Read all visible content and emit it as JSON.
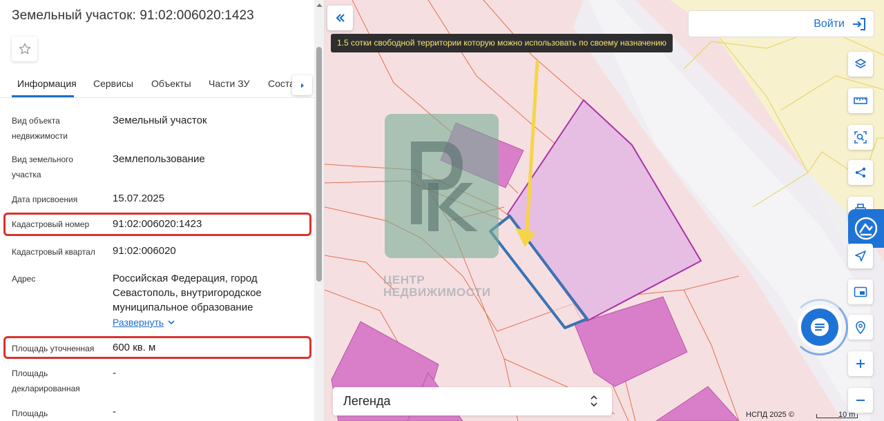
{
  "panel": {
    "title": "Земельный участок: 91:02:006020:1423",
    "tabs": [
      {
        "label": "Информация"
      },
      {
        "label": "Сервисы"
      },
      {
        "label": "Объекты"
      },
      {
        "label": "Части ЗУ"
      },
      {
        "label": "Соста"
      }
    ],
    "rows": [
      {
        "label": "Вид объекта недвижимости",
        "value": "Земельный участок"
      },
      {
        "label": "Вид земельного участка",
        "value": "Землепользование"
      },
      {
        "label": "Дата присвоения",
        "value": "15.07.2025"
      },
      {
        "label": "Кадастровый номер",
        "value": "91:02:006020:1423"
      },
      {
        "label": "Кадастровый квартал",
        "value": "91:02:006020"
      },
      {
        "label": "Адрес",
        "value": "Российская Федерация, город Севастополь, внутригородское муниципальное образование"
      },
      {
        "label": "Площадь уточненная",
        "value": "600 кв. м"
      },
      {
        "label": "Площадь декларированная",
        "value": "-"
      },
      {
        "label": "Площадь",
        "value": "-"
      }
    ],
    "expand_label": "Развернуть"
  },
  "map": {
    "tooltip": "1.5 сотки свободной территории которую можно использовать по своему назначению",
    "login_label": "Войти",
    "legend_label": "Легенда",
    "copyright": "НСПД 2025 ©",
    "scale": "10 m",
    "watermark_line1": "ЦЕНТР",
    "watermark_line2": "НЕДВИЖИМОСТИ",
    "watermark_logo": "РК",
    "tools": [
      {
        "icon": "layers-icon"
      },
      {
        "icon": "ruler-icon"
      },
      {
        "icon": "area-search-icon"
      },
      {
        "icon": "share-icon"
      },
      {
        "icon": "print-icon"
      },
      {
        "icon": "navigate-icon"
      },
      {
        "icon": "picture-in-picture-icon"
      },
      {
        "icon": "location-search-icon"
      },
      {
        "icon": "zoom-in-icon"
      },
      {
        "icon": "zoom-out-icon"
      }
    ]
  },
  "colors": {
    "accent": "#1a6fd0",
    "highlight_box": "#d9322c",
    "parcel_fill": "#f6dfe1",
    "building_fill": "#d97fc9",
    "selected_parcel_outline": "#3a73b5",
    "arrow": "#f5d547"
  }
}
